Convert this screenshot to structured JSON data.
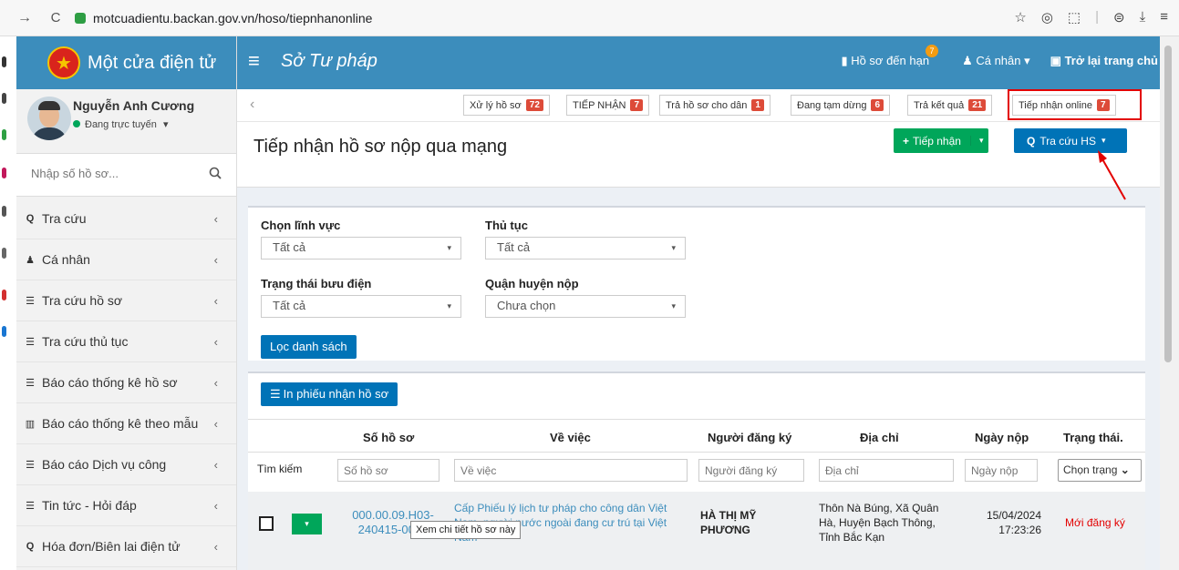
{
  "browser": {
    "url": "motcuadientu.backan.gov.vn/hoso/tiepnhanonline",
    "forward": "→",
    "reload": "C",
    "icons": [
      "☆",
      "◎",
      "⬚",
      "|",
      "⊜",
      "⤓",
      "≡"
    ]
  },
  "sidebar": {
    "app_title": "Một cửa điện tử",
    "user_name": "Nguyễn Anh Cương",
    "user_status": "Đang trực tuyến",
    "status_caret": "▾",
    "search_placeholder": "Nhập số hồ sơ...",
    "items": [
      {
        "label": "Tra cứu",
        "icon": "Q"
      },
      {
        "label": "Cá nhân",
        "icon": "♟"
      },
      {
        "label": "Tra cứu hồ sơ",
        "icon": "☰"
      },
      {
        "label": "Tra cứu thủ tục",
        "icon": "☰"
      },
      {
        "label": "Báo cáo thống kê hồ sơ",
        "icon": "☰"
      },
      {
        "label": "Báo cáo thống kê theo mẫu",
        "icon": "▥"
      },
      {
        "label": "Báo cáo Dịch vụ công",
        "icon": "☰"
      },
      {
        "label": "Tin tức - Hỏi đáp",
        "icon": "☰"
      },
      {
        "label": "Hóa đơn/Biên lai điện tử",
        "icon": "Q"
      }
    ],
    "arrow": "‹"
  },
  "header": {
    "menu_icon": "≡",
    "title": "Sở Tư pháp",
    "due_label": "Hồ sơ đến hạn",
    "due_count": "7",
    "personal_label": "Cá nhân",
    "back_label": "Trở lại trang chủ",
    "caret": "▾"
  },
  "tabs": {
    "back": "‹",
    "items": [
      {
        "label": "Xử lý hồ sơ",
        "count": "72"
      },
      {
        "label": "TIẾP NHẬN",
        "count": "7"
      },
      {
        "label": "Trả hồ sơ cho dân",
        "count": "1"
      },
      {
        "label": "Đang tạm dừng",
        "count": "6"
      },
      {
        "label": "Trả kết quả",
        "count": "21"
      },
      {
        "label": "Tiếp nhận online",
        "count": "7"
      }
    ]
  },
  "page": {
    "title": "Tiếp nhận hồ sơ nộp qua mạng",
    "receive_button": "Tiếp nhận",
    "lookup_button": "Tra cứu HS",
    "plus": "+",
    "caret": "▾",
    "search_glyph": "Q"
  },
  "filters": {
    "field_label": "Chọn lĩnh vực",
    "field_value": "Tất cả",
    "procedure_label": "Thủ tục",
    "procedure_value": "Tất cả",
    "post_label": "Trạng thái bưu điện",
    "post_value": "Tất cả",
    "district_label": "Quận huyện nộp",
    "district_value": "Chưa chọn",
    "filter_button": "Lọc danh sách",
    "caret": "▾"
  },
  "table": {
    "print_button": "In phiếu nhận hồ sơ",
    "print_icon": "☰",
    "columns": [
      "Số hồ sơ",
      "Về việc",
      "Người đăng ký",
      "Địa chỉ",
      "Ngày nộp",
      "Trạng thái."
    ],
    "search_label": "Tìm kiếm",
    "placeholders": {
      "number": "Số hồ sơ",
      "subject": "Về việc",
      "registrant": "Người đăng ký",
      "address": "Địa chỉ",
      "date": "Ngày nộp"
    },
    "status_select": "Chọn trạng",
    "select_caret": "⌄",
    "row_caret": "▾",
    "rows": [
      {
        "number_l1": "000.00.09.H03-",
        "number_l2": "240415-0015",
        "subject_l1": "Cấp Phiếu lý lịch tư pháp cho công dân Việt",
        "subject_l2": "Nam, người nước ngoài đang cư trú tại Việt",
        "subject_l3": "Nam",
        "registrant_l1": "HÀ THỊ MỸ",
        "registrant_l2": "PHƯƠNG",
        "address_l1": "Thôn Nà Búng, Xã Quân",
        "address_l2": "Hà, Huyện Bạch Thông,",
        "address_l3": "Tỉnh Bắc Kạn",
        "date_l1": "15/04/2024",
        "date_l2": "17:23:26",
        "status": "Mới đăng ký"
      }
    ],
    "tooltip": "Xem chi tiết hồ sơ này"
  },
  "colors": {
    "brand": "#3c8dbc",
    "success": "#00a65a",
    "primary": "#0073b7",
    "badge": "#dd4b39",
    "highlight": "#e30000",
    "link": "#3c8dbc",
    "status_new": "#e30000"
  }
}
